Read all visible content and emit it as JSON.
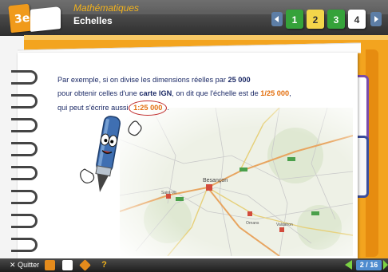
{
  "header": {
    "subject": "Mathématiques",
    "chapter": "Echelles",
    "logo_label": "3e",
    "page_tabs": [
      "1",
      "2",
      "3",
      "4"
    ],
    "current_tab": "2"
  },
  "content": {
    "line1_pre": "Par exemple, si on divise les dimensions réelles par ",
    "line1_num": "25 000",
    "line2_pre": "pour obtenir celles d'une ",
    "line2_bold": "carte IGN",
    "line2_mid": ", on dit que l'échelle est de ",
    "line2_num": "1/25 000",
    "line2_end": ",",
    "line3_pre": "qui peut s'écrire aussi ",
    "line3_num": "1:25 000",
    "line3_end": "."
  },
  "map": {
    "city_main": "Besançon",
    "labels": [
      "Ornans",
      "Saint-Vit",
      "Valdahon"
    ]
  },
  "footer": {
    "quit_label": "Quitter",
    "page_indicator": "2 / 16"
  },
  "colors": {
    "accent_orange": "#f3a41f",
    "highlight_number": "#e36f0e",
    "text_blue": "#1c2a66",
    "tab_green": "#35a23a",
    "tab_purple": "#7a4caa",
    "tab_blue": "#3a4d9c"
  },
  "icons": [
    "logo-icon",
    "book-icon",
    "prev-arrow-icon",
    "next-arrow-icon",
    "close-icon",
    "sound-icon",
    "document-icon",
    "diamond-icon",
    "help-icon",
    "pen-mascot-icon",
    "map-image"
  ]
}
